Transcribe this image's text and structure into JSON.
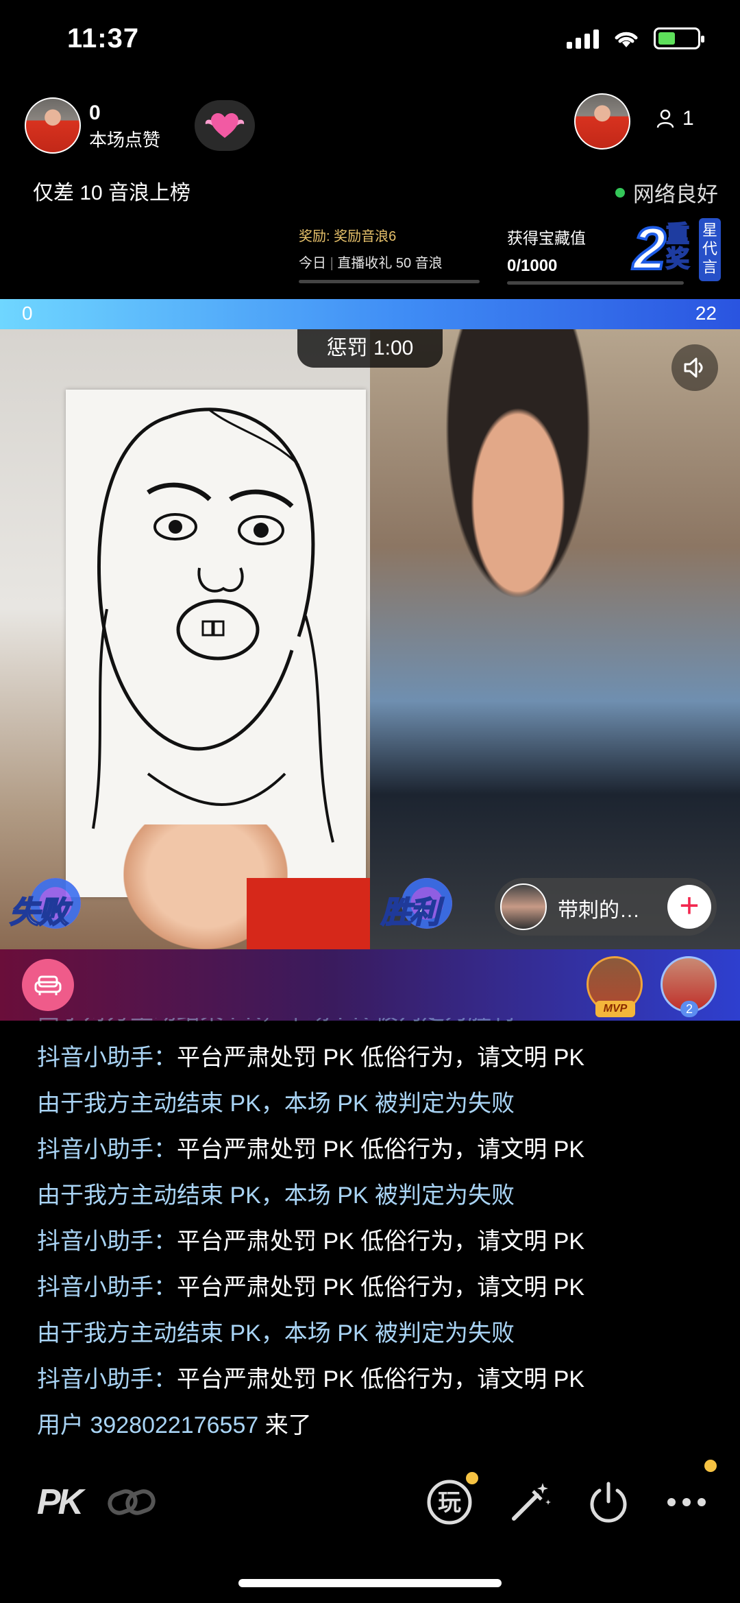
{
  "status_bar": {
    "time": "11:37"
  },
  "header": {
    "like_count": "0",
    "like_label": "本场点赞",
    "viewer_count": "1",
    "rank_text": "仅差 10 音浪上榜",
    "network_status": "网络良好"
  },
  "reward": {
    "line1": "奖励: 奖励音浪6",
    "line2_prefix": "今日",
    "line2": "直播收礼 50 音浪"
  },
  "treasure": {
    "label": "获得宝藏值",
    "value": "0/1000"
  },
  "star_badge": {
    "number": "2",
    "zhong": "重",
    "jiang": "奖",
    "side_text": "星代言"
  },
  "pk": {
    "left_score": "0",
    "right_score": "22",
    "penalty_label": "惩罚 1:00",
    "left_result": "失败",
    "right_result": "胜利",
    "opponent_name": "带刺的…",
    "follow_symbol": "+"
  },
  "contributors": {
    "mvp_label": "MVP",
    "second_rank": "2"
  },
  "chat": [
    {
      "type": "sys",
      "text": "由于对方主动结束 PK，本场 PK 被判定为胜利",
      "faded": true
    },
    {
      "type": "user",
      "name": "抖音小助手：",
      "msg": "平台严肃处罚 PK 低俗行为，请文明 PK"
    },
    {
      "type": "sys",
      "text": "由于我方主动结束 PK，本场 PK 被判定为失败"
    },
    {
      "type": "user",
      "name": "抖音小助手：",
      "msg": "平台严肃处罚 PK 低俗行为，请文明 PK"
    },
    {
      "type": "sys",
      "text": "由于我方主动结束 PK，本场 PK 被判定为失败"
    },
    {
      "type": "user",
      "name": "抖音小助手：",
      "msg": "平台严肃处罚 PK 低俗行为，请文明 PK"
    },
    {
      "type": "user",
      "name": "抖音小助手：",
      "msg": "平台严肃处罚 PK 低俗行为，请文明 PK"
    },
    {
      "type": "sys",
      "text": "由于我方主动结束 PK，本场 PK 被判定为失败"
    },
    {
      "type": "user",
      "name": "抖音小助手：",
      "msg": "平台严肃处罚 PK 低俗行为，请文明 PK"
    },
    {
      "type": "user",
      "name": "用户 3928022176557",
      "msg": " 来了"
    }
  ],
  "toolbar": {
    "pk_label": "PK",
    "play_label": "玩",
    "icons": [
      "pk-icon",
      "link-icon",
      "play-icon",
      "magic-wand-icon",
      "power-icon",
      "more-icon"
    ]
  },
  "colors": {
    "accent_blue": "#3f8cf5",
    "chat_name": "#a9d4f5",
    "notify_dot": "#f6c343",
    "follow_red": "#f2274e"
  }
}
